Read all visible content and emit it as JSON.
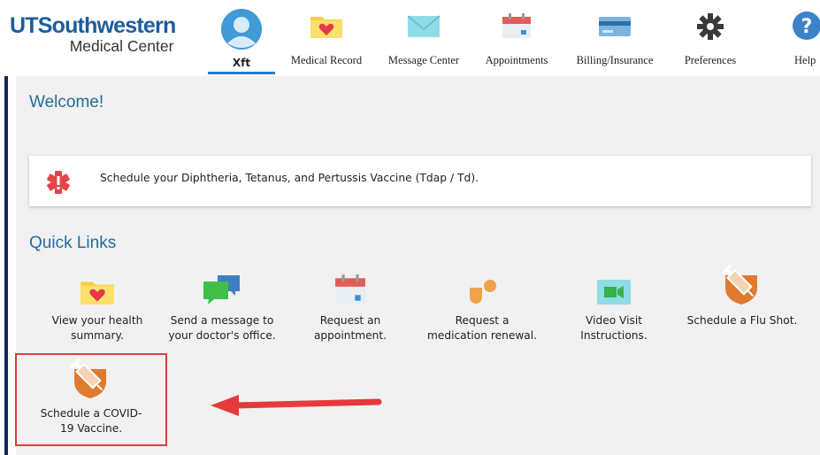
{
  "brand": {
    "name_line1": "UTSouthwestern",
    "name_line2": "Medical Center"
  },
  "nav": {
    "user_label": "Xft",
    "items": [
      {
        "label": "Medical Record",
        "icon": "folder-heart-icon"
      },
      {
        "label": "Message Center",
        "icon": "envelope-icon"
      },
      {
        "label": "Appointments",
        "icon": "calendar-icon"
      },
      {
        "label": "Billing/Insurance",
        "icon": "credit-card-icon"
      },
      {
        "label": "Preferences",
        "icon": "gear-icon"
      },
      {
        "label": "Help",
        "icon": "help-icon"
      }
    ]
  },
  "welcome": {
    "title": "Welcome!"
  },
  "alert": {
    "text": "Schedule your Diphtheria, Tetanus, and Pertussis Vaccine (Tdap / Td).",
    "icon": "medical-alert-icon"
  },
  "quick_links": {
    "title": "Quick Links",
    "items": [
      {
        "label": "View your health\nsummary.",
        "icon": "folder-heart-icon"
      },
      {
        "label": "Send a message to\nyour doctor's office.",
        "icon": "chat-bubbles-icon"
      },
      {
        "label": "Request an\nappointment.",
        "icon": "calendar-icon"
      },
      {
        "label": "Request a\nmedication renewal.",
        "icon": "pill-icon"
      },
      {
        "label": "Video Visit\nInstructions.",
        "icon": "video-camera-icon"
      },
      {
        "label": "Schedule a Flu Shot.",
        "icon": "syringe-icon"
      },
      {
        "label": "Schedule a COVID-\n19 Vaccine.",
        "icon": "syringe-icon"
      }
    ]
  },
  "colors": {
    "brand_blue": "#1c5d9e",
    "heading_blue": "#1f6e97",
    "highlight_red": "#e03c3c",
    "shot_orange": "#e07a2e"
  }
}
